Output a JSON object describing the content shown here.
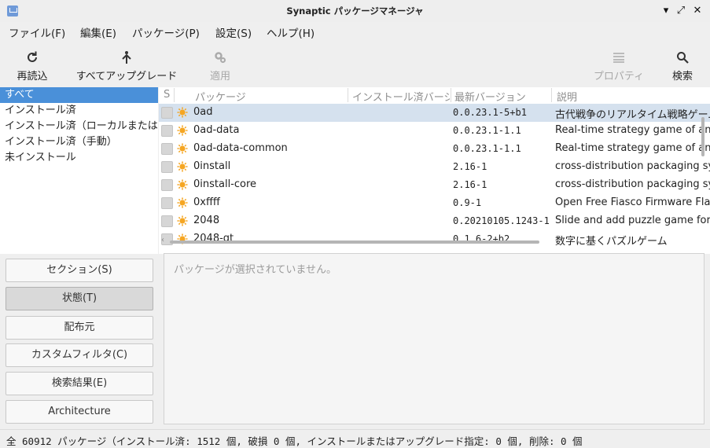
{
  "window": {
    "title": "Synaptic パッケージマネージャ",
    "controls": {
      "minimize": "▾",
      "restore": "⤢",
      "close": "✕"
    }
  },
  "menu": [
    "ファイル(F)",
    "編集(E)",
    "パッケージ(P)",
    "設定(S)",
    "ヘルプ(H)"
  ],
  "toolbar": {
    "reload": "再読込",
    "upgrade_all": "すべてアップグレード",
    "apply": "適用",
    "properties": "プロパティ",
    "search": "検索"
  },
  "filters": {
    "items": [
      "すべて",
      "インストール済",
      "インストール済（ローカルまたは廃止済）",
      "インストール済（手動）",
      "未インストール"
    ],
    "selected_index": 0
  },
  "table": {
    "headers": {
      "s": "S",
      "package": "パッケージ",
      "installed_version": "インストール済バージョン",
      "latest_version": "最新バージョン",
      "description": "説明"
    },
    "rows": [
      {
        "name": "0ad",
        "installed": "",
        "latest": "0.0.23.1-5+b1",
        "desc": "古代戦争のリアルタイム戦略ゲーム"
      },
      {
        "name": "0ad-data",
        "installed": "",
        "latest": "0.0.23.1-1.1",
        "desc": "Real-time strategy game of ancient warfare (data files)"
      },
      {
        "name": "0ad-data-common",
        "installed": "",
        "latest": "0.0.23.1-1.1",
        "desc": "Real-time strategy game of ancient warfare (common data files)"
      },
      {
        "name": "0install",
        "installed": "",
        "latest": "2.16-1",
        "desc": "cross-distribution packaging system"
      },
      {
        "name": "0install-core",
        "installed": "",
        "latest": "2.16-1",
        "desc": "cross-distribution packaging system (non-GTK version)"
      },
      {
        "name": "0xffff",
        "installed": "",
        "latest": "0.9-1",
        "desc": "Open Free Fiasco Firmware Flasher"
      },
      {
        "name": "2048",
        "installed": "",
        "latest": "0.20210105.1243-1",
        "desc": "Slide and add puzzle game for text mode"
      },
      {
        "name": "2048-qt",
        "installed": "",
        "latest": "0.1.6-2+b2",
        "desc": "数字に基くパズルゲーム"
      }
    ],
    "selected_index": 0
  },
  "filter_buttons": {
    "section": "セクション(S)",
    "status": "状態(T)",
    "origin": "配布元",
    "custom": "カスタムフィルタ(C)",
    "search_results": "検索結果(E)",
    "architecture": "Architecture",
    "active": "status"
  },
  "details": {
    "placeholder": "パッケージが選択されていません。"
  },
  "status": "全 60912 パッケージ（インストール済: 1512 個, 破損 0 個, インストールまたはアップグレード指定: 0 個, 削除: 0 個",
  "colors": {
    "selection": "#4a90d9",
    "row_selection": "#d5e1ee",
    "package_icon": "#f5a623",
    "disabled": "#a8a8a8"
  }
}
